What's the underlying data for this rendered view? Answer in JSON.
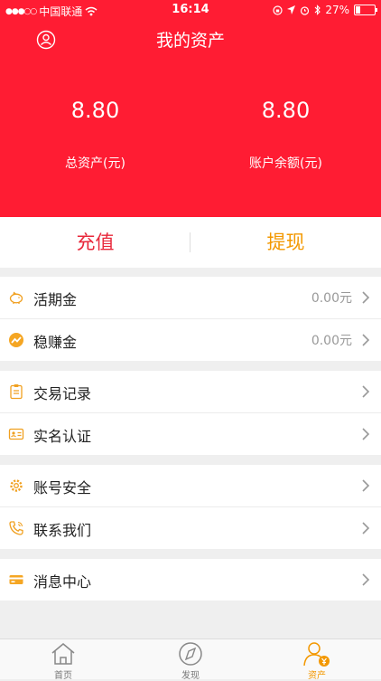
{
  "status_bar": {
    "carrier": "中国联通",
    "time": "16:14",
    "battery": "27%",
    "battery_level": 0.27
  },
  "header": {
    "title": "我的资产",
    "total_assets": {
      "value": "8.80",
      "label": "总资产(元)"
    },
    "balance": {
      "value": "8.80",
      "label": "账户余额(元)"
    }
  },
  "actions": {
    "recharge": "充值",
    "withdraw": "提现"
  },
  "groups": {
    "investments": [
      {
        "label": "活期金",
        "value": "0.00元"
      },
      {
        "label": "稳赚金",
        "value": "0.00元"
      }
    ],
    "records": [
      {
        "label": "交易记录"
      },
      {
        "label": "实名认证"
      }
    ],
    "account": [
      {
        "label": "账号安全"
      },
      {
        "label": "联系我们"
      }
    ],
    "messages": [
      {
        "label": "消息中心"
      }
    ]
  },
  "tabs": [
    {
      "label": "首页",
      "icon": "home-icon"
    },
    {
      "label": "发现",
      "icon": "compass-icon"
    },
    {
      "label": "资产",
      "icon": "assets-icon",
      "active": true
    }
  ],
  "colors": {
    "header_red": "#ff1c33",
    "recharge_red": "#e8283b",
    "accent_orange": "#f39800"
  }
}
